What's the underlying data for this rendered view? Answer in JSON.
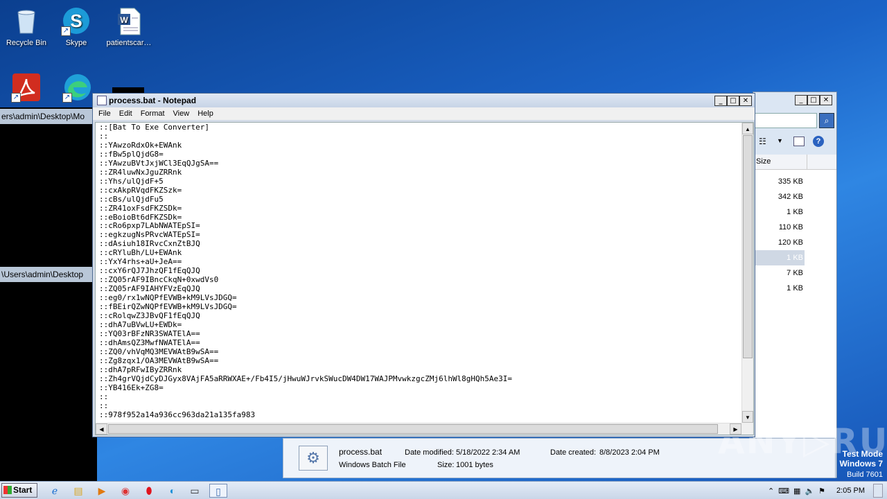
{
  "desktop": {
    "icons": [
      {
        "label": "Recycle Bin",
        "icon": "recycle-bin-icon"
      },
      {
        "label": "Skype",
        "icon": "skype-icon"
      },
      {
        "label": "patientscar…",
        "icon": "word-document-icon"
      },
      {
        "label": "",
        "icon": "acrobat-icon"
      },
      {
        "label": "",
        "icon": "edge-icon"
      }
    ]
  },
  "consoles": {
    "top_title": "ers\\admin\\Desktop\\Mo",
    "bottom_title": "\\Users\\admin\\Desktop"
  },
  "notepad": {
    "title": "process.bat - Notepad",
    "menu": [
      "File",
      "Edit",
      "Format",
      "View",
      "Help"
    ],
    "lines": [
      "::[Bat To Exe Converter]",
      "::",
      "::YAwzoRdxOk+EWAnk",
      "::fBw5plQjdG8=",
      "::YAwzuBVtJxjWCl3EqQJgSA==",
      "::ZR4luwNxJguZRRnk",
      "::Yhs/ulQjdF+5",
      "::cxAkpRVqdFKZSzk=",
      "::cBs/ulQjdFu5",
      "::ZR41oxFsdFKZSDk=",
      "::eBoioBt6dFKZSDk=",
      "::cRo6pxp7LAbNWATEpSI=",
      "::egkzugNsPRvcWATEpSI=",
      "::dAsiuh18IRvcCxnZtBJQ",
      "::cRYluBh/LU+EWAnk",
      "::YxY4rhs+aU+JeA==",
      "::cxY6rQJ7JhzQF1fEqQJQ",
      "::ZQ05rAF9IBncCkqN+0xwdVs0",
      "::ZQ05rAF9IAHYFVzEqQJQ",
      "::eg0/rx1wNQPfEVWB+kM9LVsJDGQ=",
      "::fBEirQZwNQPfEVWB+kM9LVsJDGQ=",
      "::cRolqwZ3JBvQF1fEqQJQ",
      "::dhA7uBVwLU+EWDk=",
      "::YQ03rBFzNR3SWATElA==",
      "::dhAmsQZ3MwfNWATElA==",
      "::ZQ0/vhVqMQ3MEVWAtB9wSA==",
      "::Zg8zqx1/OA3MEVWAtB9wSA==",
      "::dhA7pRFwIByZRRnk",
      "::Zh4grVQjdCyDJGyx8VAjFA5aRRWXAE+/Fb4I5/jHwuWJrvkSWucDW4DW17WAJPMvwkzgcZMj6lhWl8gHQh5Ae3I=",
      "::YB416Ek+ZG8=",
      "::",
      "::",
      "::978f952a14a936cc963da21a135fa983"
    ]
  },
  "explorer": {
    "column_header": "Size",
    "sizes": [
      "335 KB",
      "342 KB",
      "1 KB",
      "110 KB",
      "120 KB",
      "1 KB",
      "7 KB",
      "1 KB"
    ],
    "selected_index": 5
  },
  "details": {
    "filename": "process.bat",
    "filetype": "Windows Batch File",
    "date_modified_label": "Date modified:",
    "date_modified": "5/18/2022 2:34 AM",
    "size_label": "Size:",
    "size": "1001 bytes",
    "date_created_label": "Date created:",
    "date_created": "8/8/2023 2:04 PM"
  },
  "watermark": {
    "text": "ANY▷RUN",
    "test_mode_line1": "Test Mode",
    "test_mode_line2": "Windows 7",
    "build": "Build 7601"
  },
  "taskbar": {
    "start_label": "Start",
    "apps": [
      "ie-icon",
      "explorer-icon",
      "media-player-icon",
      "chrome-icon",
      "opera-icon",
      "edge-icon",
      "cmd-icon",
      "notepad-icon"
    ],
    "clock": "2:05 PM"
  }
}
